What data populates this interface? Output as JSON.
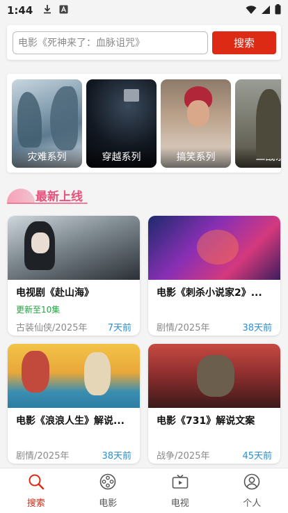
{
  "status": {
    "time": "1:44"
  },
  "search": {
    "placeholder": "电影《死神来了：血脉诅咒》",
    "button": "搜索"
  },
  "categories": [
    {
      "label": "灾难系列"
    },
    {
      "label": "穿越系列"
    },
    {
      "label": "搞笑系列"
    },
    {
      "label": "二战系"
    }
  ],
  "section": {
    "title": "最新上线"
  },
  "cards": [
    {
      "title": "电视剧《赴山海》",
      "update": "更新至10集",
      "meta": "古装仙侠/2025年",
      "ago": "7天前"
    },
    {
      "title": "电影《刺杀小说家2》...",
      "update": "",
      "meta": "剧情/2025年",
      "ago": "38天前"
    },
    {
      "title": "电影《浪浪人生》解说...",
      "update": "",
      "meta": "剧情/2025年",
      "ago": "38天前"
    },
    {
      "title": "电影《731》解说文案",
      "update": "",
      "meta": "战争/2025年",
      "ago": "45天前"
    }
  ],
  "nav": [
    {
      "label": "搜索",
      "icon": "search-icon",
      "active": true
    },
    {
      "label": "电影",
      "icon": "film-reel-icon"
    },
    {
      "label": "电视",
      "icon": "tv-icon"
    },
    {
      "label": "个人",
      "icon": "person-icon"
    }
  ],
  "colors": {
    "accent": "#dd2a14",
    "section": "#e7517b",
    "update_green": "#25a343",
    "time_blue": "#2a8fd6"
  }
}
